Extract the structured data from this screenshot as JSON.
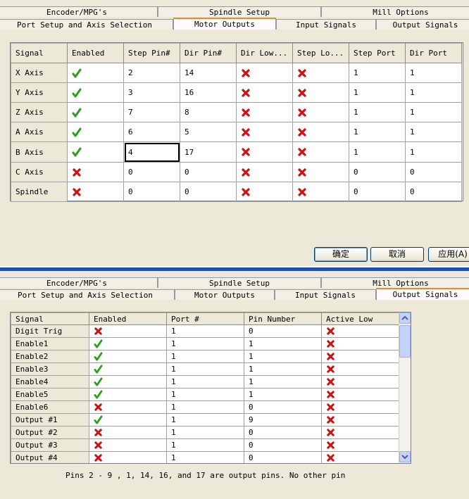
{
  "top_dialog": {
    "tab_rows": [
      [
        "Encoder/MPG's",
        "Spindle Setup",
        "Mill Options"
      ],
      [
        "Port Setup and Axis Selection",
        "Motor Outputs",
        "Input Signals",
        "Output Signals"
      ]
    ],
    "active_tab": "Motor Outputs",
    "motor_outputs": {
      "columns": [
        "Signal",
        "Enabled",
        "Step Pin#",
        "Dir Pin#",
        "Dir Low...",
        "Step Lo...",
        "Step Port",
        "Dir Port"
      ],
      "rows": [
        {
          "signal": "X Axis",
          "enabled": true,
          "step_pin": "2",
          "dir_pin": "14",
          "dir_low": false,
          "step_low": false,
          "step_port": "1",
          "dir_port": "1"
        },
        {
          "signal": "Y Axis",
          "enabled": true,
          "step_pin": "3",
          "dir_pin": "16",
          "dir_low": false,
          "step_low": false,
          "step_port": "1",
          "dir_port": "1"
        },
        {
          "signal": "Z Axis",
          "enabled": true,
          "step_pin": "7",
          "dir_pin": "8",
          "dir_low": false,
          "step_low": false,
          "step_port": "1",
          "dir_port": "1"
        },
        {
          "signal": "A Axis",
          "enabled": true,
          "step_pin": "6",
          "dir_pin": "5",
          "dir_low": false,
          "step_low": false,
          "step_port": "1",
          "dir_port": "1"
        },
        {
          "signal": "B Axis",
          "enabled": true,
          "step_pin": "4",
          "dir_pin": "17",
          "dir_low": false,
          "step_low": false,
          "step_port": "1",
          "dir_port": "1",
          "focused": true
        },
        {
          "signal": "C Axis",
          "enabled": false,
          "step_pin": "0",
          "dir_pin": "0",
          "dir_low": false,
          "step_low": false,
          "step_port": "0",
          "dir_port": "0"
        },
        {
          "signal": "Spindle",
          "enabled": false,
          "step_pin": "0",
          "dir_pin": "0",
          "dir_low": false,
          "step_low": false,
          "step_port": "0",
          "dir_port": "0"
        }
      ]
    },
    "buttons": {
      "ok": "确定",
      "cancel": "取消",
      "apply": "应用(A)"
    }
  },
  "bottom_dialog": {
    "tab_rows": [
      [
        "Encoder/MPG's",
        "Spindle Setup",
        "Mill Options"
      ],
      [
        "Port Setup and Axis Selection",
        "Motor Outputs",
        "Input Signals",
        "Output Signals"
      ]
    ],
    "active_tab": "Output Signals",
    "output_signals": {
      "columns": [
        "Signal",
        "Enabled",
        "Port #",
        "Pin Number",
        "Active Low"
      ],
      "rows": [
        {
          "signal": "Digit  Trig",
          "enabled": false,
          "port": "1",
          "pin": "0",
          "active_low": false
        },
        {
          "signal": "Enable1",
          "enabled": true,
          "port": "1",
          "pin": "1",
          "active_low": false
        },
        {
          "signal": "Enable2",
          "enabled": true,
          "port": "1",
          "pin": "1",
          "active_low": false
        },
        {
          "signal": "Enable3",
          "enabled": true,
          "port": "1",
          "pin": "1",
          "active_low": false
        },
        {
          "signal": "Enable4",
          "enabled": true,
          "port": "1",
          "pin": "1",
          "active_low": false
        },
        {
          "signal": "Enable5",
          "enabled": true,
          "port": "1",
          "pin": "1",
          "active_low": false
        },
        {
          "signal": "Enable6",
          "enabled": false,
          "port": "1",
          "pin": "0",
          "active_low": false
        },
        {
          "signal": "Output #1",
          "enabled": true,
          "port": "1",
          "pin": "9",
          "active_low": false
        },
        {
          "signal": "Output #2",
          "enabled": false,
          "port": "1",
          "pin": "0",
          "active_low": false
        },
        {
          "signal": "Output #3",
          "enabled": false,
          "port": "1",
          "pin": "0",
          "active_low": false
        },
        {
          "signal": "Output #4",
          "enabled": false,
          "port": "1",
          "pin": "0",
          "active_low": false
        }
      ]
    },
    "note": "Pins 2 - 9 , 1, 14, 16, and 17 are output pins. No  other pin"
  },
  "icons": {
    "checked": "green-check-icon",
    "unchecked": "red-x-icon"
  },
  "colors": {
    "check": "#2e9e1e",
    "cross": "#d01010",
    "active_tab_accent": "#e68b2c"
  }
}
